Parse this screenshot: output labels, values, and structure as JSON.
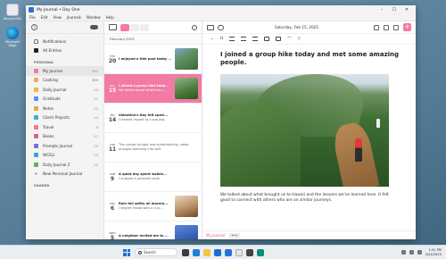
{
  "desktop": {
    "icons": [
      {
        "label": "Recycle Bin",
        "icon": "recycle-bin-icon"
      },
      {
        "label": "Microsoft Edge",
        "icon": "edge-icon"
      }
    ]
  },
  "window": {
    "title": "My Journal • Day One",
    "menu": [
      "File",
      "Edit",
      "View",
      "Journals",
      "Window",
      "Help"
    ]
  },
  "sidebar": {
    "top_items": [
      {
        "label": "Notifications",
        "icon": "bell-icon"
      },
      {
        "label": "All Entries",
        "icon": "all-entries-icon"
      }
    ],
    "personal_header": "PERSONAL",
    "journals": [
      {
        "label": "My Journal",
        "count": "350",
        "color": "#f27aa5",
        "active": true
      },
      {
        "label": "Cooking",
        "count": "388",
        "color": "#f6a75a"
      },
      {
        "label": "Daily Journal",
        "count": "19",
        "color": "#f2b43c"
      },
      {
        "label": "Gratitude",
        "count": "12",
        "color": "#5b8def"
      },
      {
        "label": "Notes",
        "count": "12",
        "color": "#f3a33c"
      },
      {
        "label": "Client Projects",
        "count": "10",
        "color": "#33b3c9"
      },
      {
        "label": "Travel",
        "count": "9",
        "color": "#f27a7a"
      },
      {
        "label": "Books",
        "count": "27",
        "color": "#d4647e"
      },
      {
        "label": "Prompts Journal",
        "count": "25",
        "color": "#7d6be0"
      },
      {
        "label": "WCELI",
        "count": "15",
        "color": "#35a3d6"
      },
      {
        "label": "Daily Journal 2",
        "count": "25",
        "color": "#57b957"
      }
    ],
    "new_journal": "New Personal Journal",
    "shared_header": "SHARED"
  },
  "list": {
    "month": "February 2025",
    "entries": [
      {
        "dow": "THU",
        "day": "20",
        "title": "I enjoyed a tide pool today and saw sea urchins, starfish, and tiny crabs.",
        "preview": "",
        "thumb": "thumb-a"
      },
      {
        "dow": "SAT",
        "day": "15",
        "title": "I joined a group hike toda...",
        "preview": "We talked about what brou...",
        "thumb": "thumb-b",
        "selected": true
      },
      {
        "dow": "FRI",
        "day": "14",
        "title": "Valentine's Day felt speci...",
        "preview": "I treated myself to a spa day",
        "thumb": ""
      },
      {
        "dow": "TUE",
        "day": "11",
        "title": "",
        "preview": "The sunset tonight was breathtaking—deep oranges blending into soft",
        "thumb": ""
      },
      {
        "dow": "SUN",
        "day": "9",
        "title": "A quiet day spent walkin...",
        "preview": "I enjoyed a peaceful walk",
        "thumb": ""
      },
      {
        "dow": "THU",
        "day": "6",
        "title": "Rain fell softly all mornin...",
        "preview": "I stayed inside with a cup ...",
        "thumb": "thumb-c"
      },
      {
        "dow": "WED",
        "day": "5",
        "title": "A neighbor invited me to ...",
        "preview": "",
        "thumb": "thumb-d"
      }
    ]
  },
  "editor": {
    "date": "Saturday, Feb 15, 2025",
    "heading_label": "H",
    "heading": "I joined a group hike today and met some amazing people.",
    "paragraph": "We talked about what brought us to Hawaii and the lessons we've learned here. It felt good to connect with others who are on similar journeys.",
    "journal_tag": "My Journal",
    "more": "•••"
  },
  "taskbar": {
    "search_placeholder": "Search",
    "time": "1:51 PM",
    "date": "2/24/2025"
  }
}
